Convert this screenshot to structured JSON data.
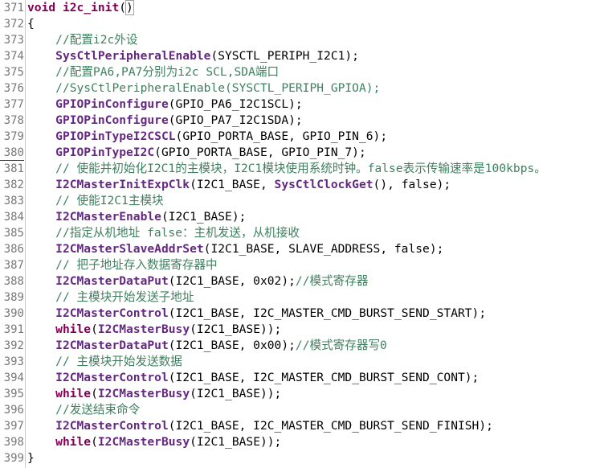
{
  "editor": {
    "lines": [
      {
        "num": "371",
        "tokens": [
          {
            "t": "void",
            "s": "k"
          },
          {
            "t": " ",
            "s": "p"
          },
          {
            "t": "i2c_init",
            "s": "k"
          },
          {
            "t": "(",
            "s": "p"
          },
          {
            "t": ")",
            "s": "p",
            "bracket": true
          }
        ]
      },
      {
        "num": "372",
        "tokens": [
          {
            "t": "{",
            "s": "p"
          }
        ]
      },
      {
        "num": "373",
        "tokens": [
          {
            "t": "    ",
            "s": "p"
          },
          {
            "t": "//配置i2c外设",
            "s": "c"
          }
        ]
      },
      {
        "num": "374",
        "tokens": [
          {
            "t": "    ",
            "s": "p"
          },
          {
            "t": "SysCtlPeripheralEnable",
            "s": "f"
          },
          {
            "t": "(SYSCTL_PERIPH_I2C1);",
            "s": "p"
          }
        ]
      },
      {
        "num": "375",
        "tokens": [
          {
            "t": "    ",
            "s": "p"
          },
          {
            "t": "//配置PA6,PA7分别为i2c SCL,SDA端口",
            "s": "c"
          }
        ]
      },
      {
        "num": "376",
        "tokens": [
          {
            "t": "    ",
            "s": "p"
          },
          {
            "t": "//SysCtlPeripheralEnable(SYSCTL_PERIPH_GPIOA);",
            "s": "c"
          }
        ]
      },
      {
        "num": "377",
        "tokens": [
          {
            "t": "    ",
            "s": "p"
          },
          {
            "t": "GPIOPinConfigure",
            "s": "f"
          },
          {
            "t": "(GPIO_PA6_I2C1SCL);",
            "s": "p"
          }
        ]
      },
      {
        "num": "378",
        "tokens": [
          {
            "t": "    ",
            "s": "p"
          },
          {
            "t": "GPIOPinConfigure",
            "s": "f"
          },
          {
            "t": "(GPIO_PA7_I2C1SDA);",
            "s": "p"
          }
        ]
      },
      {
        "num": "379",
        "tokens": [
          {
            "t": "    ",
            "s": "p"
          },
          {
            "t": "GPIOPinTypeI2CSCL",
            "s": "f"
          },
          {
            "t": "(GPIO_PORTA_BASE, GPIO_PIN_6);",
            "s": "p"
          }
        ]
      },
      {
        "num": "380",
        "current": true,
        "tokens": [
          {
            "t": "    ",
            "s": "p"
          },
          {
            "t": "GPIOPinTypeI2C",
            "s": "f"
          },
          {
            "t": "(GPIO_PORTA_BASE, GPIO_PIN_7);",
            "s": "p"
          }
        ]
      },
      {
        "num": "381",
        "tokens": [
          {
            "t": "    ",
            "s": "p"
          },
          {
            "t": "// 使能并初始化I2C1的主模块，I2C1模块使用系统时钟。false表示传输速率是100kbps。",
            "s": "c"
          }
        ]
      },
      {
        "num": "382",
        "tokens": [
          {
            "t": "    ",
            "s": "p"
          },
          {
            "t": "I2CMasterInitExpClk",
            "s": "f"
          },
          {
            "t": "(I2C1_BASE, ",
            "s": "p"
          },
          {
            "t": "SysCtlClockGet",
            "s": "f"
          },
          {
            "t": "(), false);",
            "s": "p"
          }
        ]
      },
      {
        "num": "383",
        "tokens": [
          {
            "t": "    ",
            "s": "p"
          },
          {
            "t": "// 使能I2C1主模块",
            "s": "c"
          }
        ]
      },
      {
        "num": "384",
        "tokens": [
          {
            "t": "    ",
            "s": "p"
          },
          {
            "t": "I2CMasterEnable",
            "s": "f"
          },
          {
            "t": "(I2C1_BASE);",
            "s": "p"
          }
        ]
      },
      {
        "num": "385",
        "tokens": [
          {
            "t": "    ",
            "s": "p"
          },
          {
            "t": "//指定从机地址 false：主机发送，从机接收",
            "s": "c"
          }
        ]
      },
      {
        "num": "386",
        "tokens": [
          {
            "t": "    ",
            "s": "p"
          },
          {
            "t": "I2CMasterSlaveAddrSet",
            "s": "f"
          },
          {
            "t": "(I2C1_BASE, SLAVE_ADDRESS, false);",
            "s": "p"
          }
        ]
      },
      {
        "num": "387",
        "tokens": [
          {
            "t": "    ",
            "s": "p"
          },
          {
            "t": "// 把子地址存入数据寄存器中",
            "s": "c"
          }
        ]
      },
      {
        "num": "388",
        "tokens": [
          {
            "t": "    ",
            "s": "p"
          },
          {
            "t": "I2CMasterDataPut",
            "s": "f"
          },
          {
            "t": "(I2C1_BASE, 0x02);",
            "s": "p"
          },
          {
            "t": "//模式寄存器",
            "s": "c"
          }
        ]
      },
      {
        "num": "389",
        "tokens": [
          {
            "t": "    ",
            "s": "p"
          },
          {
            "t": "// 主模块开始发送子地址",
            "s": "c"
          }
        ]
      },
      {
        "num": "390",
        "tokens": [
          {
            "t": "    ",
            "s": "p"
          },
          {
            "t": "I2CMasterControl",
            "s": "f"
          },
          {
            "t": "(I2C1_BASE, I2C_MASTER_CMD_BURST_SEND_START);",
            "s": "p"
          }
        ]
      },
      {
        "num": "391",
        "tokens": [
          {
            "t": "    ",
            "s": "p"
          },
          {
            "t": "while",
            "s": "k"
          },
          {
            "t": "(",
            "s": "p"
          },
          {
            "t": "I2CMasterBusy",
            "s": "f"
          },
          {
            "t": "(I2C1_BASE));",
            "s": "p"
          }
        ]
      },
      {
        "num": "392",
        "tokens": [
          {
            "t": "    ",
            "s": "p"
          },
          {
            "t": "I2CMasterDataPut",
            "s": "f"
          },
          {
            "t": "(I2C1_BASE, 0x00);",
            "s": "p"
          },
          {
            "t": "//模式寄存器写0",
            "s": "c"
          }
        ]
      },
      {
        "num": "393",
        "tokens": [
          {
            "t": "    ",
            "s": "p"
          },
          {
            "t": "// 主模块开始发送数据",
            "s": "c"
          }
        ]
      },
      {
        "num": "394",
        "tokens": [
          {
            "t": "    ",
            "s": "p"
          },
          {
            "t": "I2CMasterControl",
            "s": "f"
          },
          {
            "t": "(I2C1_BASE, I2C_MASTER_CMD_BURST_SEND_CONT);",
            "s": "p"
          }
        ]
      },
      {
        "num": "395",
        "tokens": [
          {
            "t": "    ",
            "s": "p"
          },
          {
            "t": "while",
            "s": "k"
          },
          {
            "t": "(",
            "s": "p"
          },
          {
            "t": "I2CMasterBusy",
            "s": "f"
          },
          {
            "t": "(I2C1_BASE));",
            "s": "p"
          }
        ]
      },
      {
        "num": "396",
        "tokens": [
          {
            "t": "    ",
            "s": "p"
          },
          {
            "t": "//发送结束命令",
            "s": "c"
          }
        ]
      },
      {
        "num": "397",
        "tokens": [
          {
            "t": "    ",
            "s": "p"
          },
          {
            "t": "I2CMasterControl",
            "s": "f"
          },
          {
            "t": "(I2C1_BASE, I2C_MASTER_CMD_BURST_SEND_FINISH);",
            "s": "p"
          }
        ]
      },
      {
        "num": "398",
        "tokens": [
          {
            "t": "    ",
            "s": "p"
          },
          {
            "t": "while",
            "s": "k"
          },
          {
            "t": "(",
            "s": "p"
          },
          {
            "t": "I2CMasterBusy",
            "s": "f"
          },
          {
            "t": "(I2C1_BASE));",
            "s": "p"
          }
        ]
      },
      {
        "num": "399",
        "tokens": [
          {
            "t": "}",
            "s": "p"
          }
        ]
      }
    ]
  },
  "colors": {
    "keyword": "#7f0055",
    "function": "#642880",
    "comment": "#3f7f5f",
    "plain": "#000000",
    "line_number": "#787878"
  }
}
